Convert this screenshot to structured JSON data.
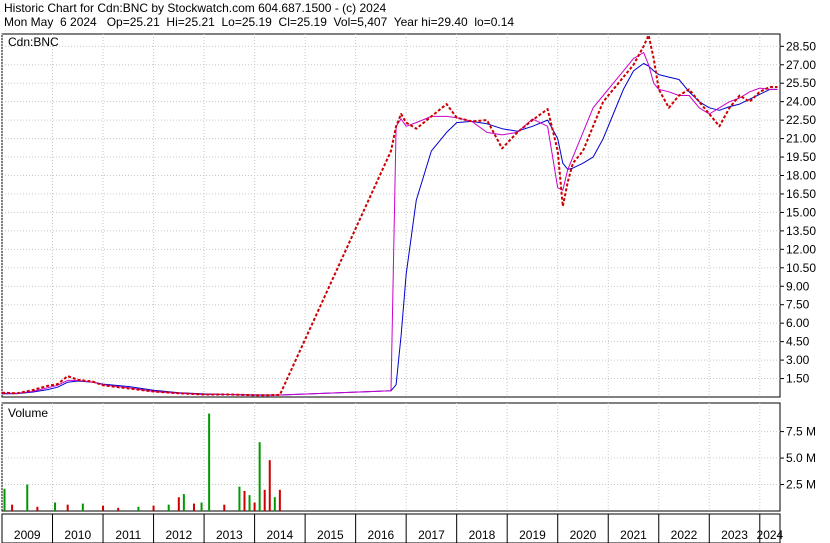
{
  "header": {
    "line1": "Historic Chart for Cdn:BNC by Stockwatch.com 604.687.1500 - (c) 2024",
    "line2": "Mon May  6 2024   Op=25.21  Hi=25.21  Lo=25.19  Cl=25.19  Vol=5,407  Year hi=29.40  lo=0.14"
  },
  "chart_data": [
    {
      "type": "line",
      "title": "Cdn:BNC",
      "xlabel": "",
      "ylabel": "",
      "x_labels": [
        "2009",
        "2010",
        "2011",
        "2012",
        "2013",
        "2014",
        "2015",
        "2016",
        "2017",
        "2018",
        "2019",
        "2020",
        "2021",
        "2022",
        "2023",
        "2024"
      ],
      "y_ticks": [
        "28.50",
        "27.00",
        "25.50",
        "24.00",
        "22.50",
        "21.00",
        "19.50",
        "18.00",
        "16.50",
        "15.00",
        "13.50",
        "12.00",
        "10.50",
        "9.00",
        "7.50",
        "6.00",
        "4.50",
        "3.00",
        "1.50"
      ],
      "ylim": [
        0,
        29.5
      ],
      "grid": true,
      "colors": {
        "price": "#cc0000",
        "ma_short": "#cc00cc",
        "ma_long": "#0000cc"
      },
      "x": [
        2009.0,
        2009.3,
        2009.6,
        2009.9,
        2010.1,
        2010.3,
        2010.5,
        2010.8,
        2011.0,
        2011.5,
        2012.0,
        2012.5,
        2013.0,
        2013.5,
        2014.0,
        2014.3,
        2014.5,
        2016.7,
        2016.8,
        2016.9,
        2017.0,
        2017.2,
        2017.5,
        2017.8,
        2018.0,
        2018.3,
        2018.6,
        2018.9,
        2019.2,
        2019.5,
        2019.8,
        2020.0,
        2020.1,
        2020.2,
        2020.3,
        2020.5,
        2020.7,
        2020.9,
        2021.1,
        2021.3,
        2021.5,
        2021.7,
        2021.8,
        2021.9,
        2022.0,
        2022.2,
        2022.4,
        2022.6,
        2022.8,
        2023.0,
        2023.2,
        2023.4,
        2023.6,
        2023.8,
        2024.0,
        2024.2,
        2024.35
      ],
      "series": [
        {
          "values": [
            0.35,
            0.3,
            0.55,
            0.9,
            1.05,
            1.7,
            1.4,
            1.25,
            0.95,
            0.7,
            0.45,
            0.3,
            0.2,
            0.2,
            0.15,
            0.15,
            0.18,
            20.0,
            22.0,
            23.0,
            22.3,
            21.8,
            22.8,
            23.8,
            22.7,
            22.4,
            22.5,
            20.2,
            21.5,
            22.5,
            23.4,
            20.0,
            15.5,
            17.5,
            19.0,
            20.0,
            22.0,
            24.0,
            25.0,
            26.0,
            27.0,
            28.5,
            29.4,
            27.5,
            25.0,
            23.5,
            24.5,
            25.0,
            24.0,
            23.0,
            22.0,
            23.5,
            24.5,
            24.0,
            24.8,
            25.2,
            25.19
          ]
        },
        {
          "values": [
            0.3,
            0.3,
            0.45,
            0.75,
            0.95,
            1.35,
            1.35,
            1.2,
            1.0,
            0.75,
            0.45,
            0.3,
            0.2,
            0.2,
            0.15,
            0.15,
            0.16,
            0.5,
            22.0,
            22.6,
            22.0,
            22.3,
            22.8,
            22.8,
            22.7,
            22.4,
            21.5,
            21.3,
            21.5,
            22.6,
            22.0,
            17.0,
            16.8,
            18.5,
            19.5,
            21.5,
            23.5,
            24.5,
            25.5,
            26.5,
            27.5,
            28.0,
            27.0,
            25.5,
            25.0,
            24.8,
            24.5,
            24.5,
            23.5,
            23.0,
            23.5,
            24.0,
            24.3,
            24.8,
            25.1,
            25.0,
            25.0
          ]
        },
        {
          "values": [
            0.25,
            0.28,
            0.4,
            0.6,
            0.8,
            1.2,
            1.3,
            1.2,
            1.05,
            0.85,
            0.55,
            0.35,
            0.25,
            0.2,
            0.17,
            0.16,
            0.16,
            0.5,
            1.0,
            5.0,
            10.0,
            16.0,
            20.0,
            21.5,
            22.3,
            22.4,
            22.2,
            21.8,
            21.6,
            22.0,
            22.5,
            21.0,
            19.0,
            18.5,
            18.6,
            19.0,
            19.5,
            21.0,
            23.0,
            25.0,
            26.5,
            27.1,
            26.9,
            26.5,
            26.2,
            26.0,
            25.8,
            24.8,
            24.0,
            23.5,
            23.3,
            23.6,
            23.8,
            24.2,
            24.6,
            25.0,
            25.0
          ]
        }
      ]
    },
    {
      "type": "bar",
      "title": "Volume",
      "y_ticks": [
        "7.5 M",
        "5.0 M",
        "2.5 M"
      ],
      "ylim": [
        0,
        10.2
      ],
      "colors": {
        "up": "#009900",
        "down": "#cc0000"
      },
      "x": [
        2009.05,
        2009.2,
        2009.5,
        2009.7,
        2010.05,
        2010.3,
        2010.6,
        2011.0,
        2011.3,
        2011.7,
        2012.0,
        2012.3,
        2012.5,
        2012.6,
        2012.8,
        2012.95,
        2013.1,
        2013.4,
        2013.7,
        2013.8,
        2013.9,
        2014.0,
        2014.1,
        2014.2,
        2014.3,
        2014.4,
        2014.5
      ],
      "values": [
        2.1,
        0.6,
        2.5,
        0.4,
        0.8,
        0.6,
        0.7,
        0.5,
        0.3,
        0.4,
        0.5,
        0.6,
        1.3,
        1.6,
        0.7,
        0.8,
        9.2,
        0.6,
        2.3,
        1.9,
        1.5,
        0.8,
        6.5,
        2.0,
        4.8,
        1.3,
        2.0
      ],
      "direction": [
        "up",
        "down",
        "up",
        "down",
        "up",
        "down",
        "up",
        "down",
        "down",
        "up",
        "down",
        "up",
        "down",
        "up",
        "down",
        "up",
        "up",
        "down",
        "up",
        "down",
        "up",
        "down",
        "up",
        "down",
        "down",
        "up",
        "down"
      ]
    }
  ]
}
